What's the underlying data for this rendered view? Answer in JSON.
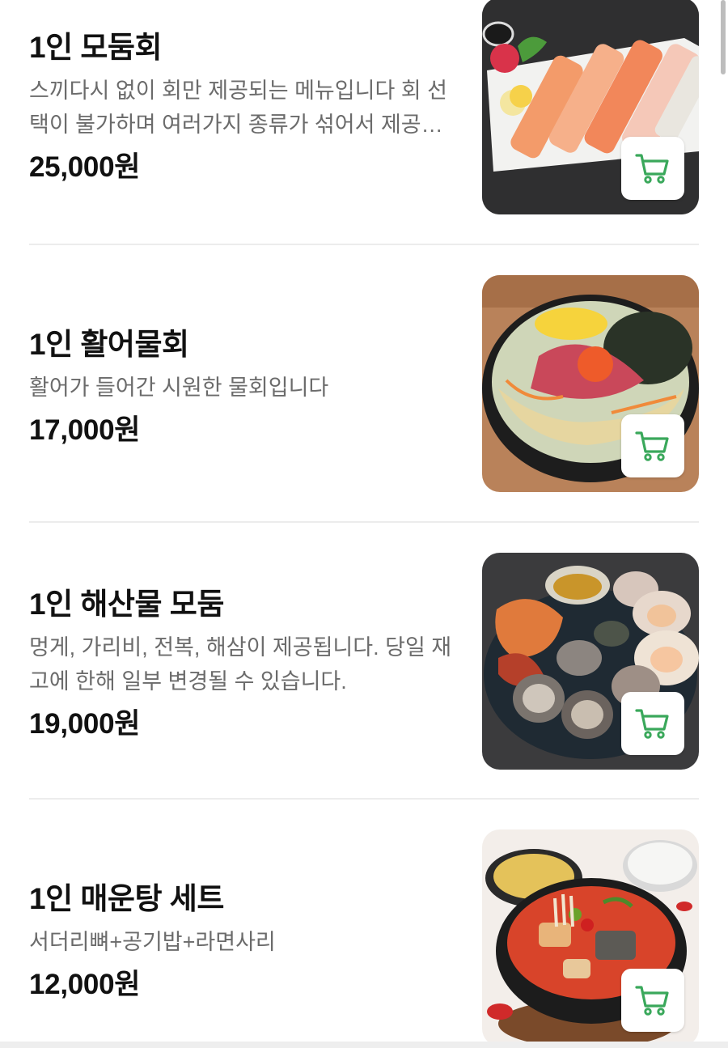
{
  "menu": {
    "items": [
      {
        "title": "1인 모둠회",
        "description": "스끼다시 없이 회만 제공되는 메뉴입니다 회 선택이 불가하며 여러가지 종류가 섞어서 제공됩니다",
        "price": "25,000원",
        "image_icon": "sashimi-platter-image",
        "cart_icon": "cart-icon"
      },
      {
        "title": "1인 활어물회",
        "description": "활어가 들어간 시원한 물회입니다",
        "price": "17,000원",
        "image_icon": "mulhoe-bowl-image",
        "cart_icon": "cart-icon"
      },
      {
        "title": "1인 해산물 모둠",
        "description": "멍게, 가리비, 전복, 해삼이 제공됩니다. 당일 재고에 한해 일부 변경될 수 있습니다.",
        "price": "19,000원",
        "image_icon": "seafood-platter-image",
        "cart_icon": "cart-icon"
      },
      {
        "title": "1인 매운탕 세트",
        "description": "서더리뼈+공기밥+라면사리",
        "price": "12,000원",
        "image_icon": "maeuntang-set-image",
        "cart_icon": "cart-icon"
      }
    ]
  },
  "colors": {
    "cart_accent": "#3aa85b",
    "divider": "#ececec",
    "description_text": "#6b6b6b"
  }
}
